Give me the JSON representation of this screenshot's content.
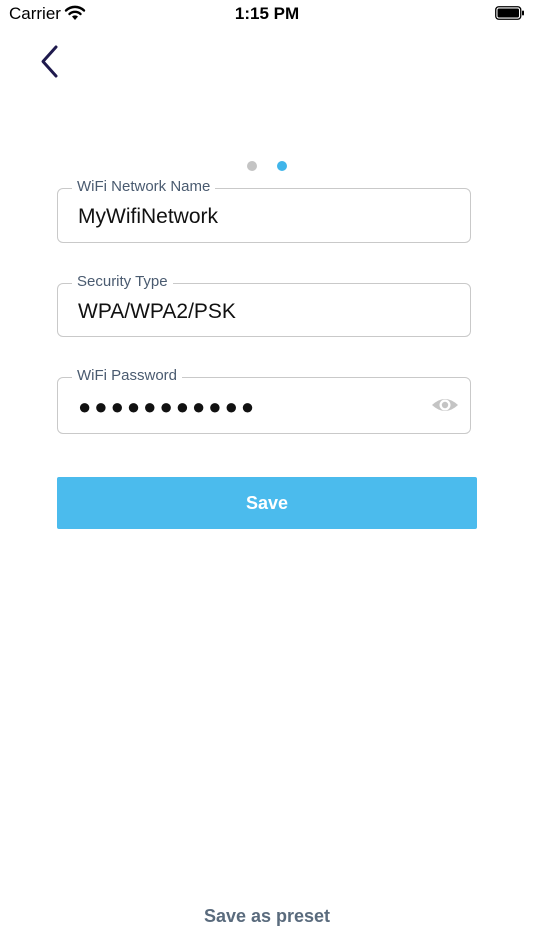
{
  "status_bar": {
    "carrier": "Carrier",
    "time": "1:15 PM",
    "wifi_icon": "wifi-icon",
    "battery_icon": "battery-icon"
  },
  "nav": {
    "back_icon": "chevron-left-icon"
  },
  "pager": {
    "total_pages": 2,
    "current_page": 2
  },
  "form": {
    "network_name": {
      "label": "WiFi Network Name",
      "value": "MyWifiNetwork"
    },
    "security_type": {
      "label": "Security Type",
      "value": "WPA/WPA2/PSK"
    },
    "password": {
      "label": "WiFi Password",
      "masked_value": "●●●●●●●●●●●",
      "toggle_icon": "eye-icon"
    }
  },
  "actions": {
    "save_label": "Save",
    "save_preset_label": "Save as preset"
  },
  "colors": {
    "accent": "#4bbbed",
    "dot_active": "#40b5ea",
    "dot_inactive": "#c4c4c4",
    "back_icon": "#1f1a4d",
    "label_text": "#4a5b70",
    "preset_text": "#5a6b7d"
  }
}
